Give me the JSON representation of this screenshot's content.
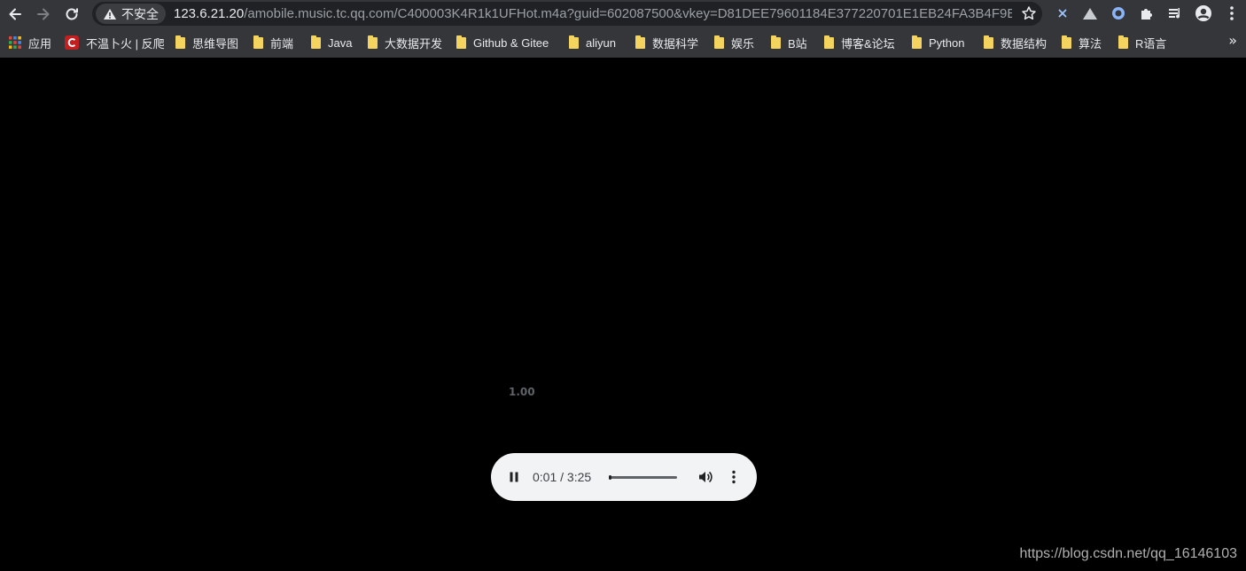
{
  "address_bar": {
    "security_label": "不安全",
    "url_host": "123.6.21.20",
    "url_path": "/amobile.music.tc.qq.com/C400003K4R1k1UFHot.m4a?guid=602087500&vkey=D81DEE79601184E377220701E1EB24FA3B4F9B..."
  },
  "bookmarks": [
    {
      "label": "应用",
      "icon": "apps-grid-icon"
    },
    {
      "label": "不温卜火 | 反爬",
      "icon": "csdn-icon"
    },
    {
      "label": "思维导图",
      "icon": "folder-icon"
    },
    {
      "label": "前端",
      "icon": "folder-icon"
    },
    {
      "label": "Java",
      "icon": "folder-icon"
    },
    {
      "label": "大数据开发",
      "icon": "folder-icon"
    },
    {
      "label": "Github & Gitee",
      "icon": "folder-icon"
    },
    {
      "label": "aliyun",
      "icon": "folder-icon"
    },
    {
      "label": "数据科学",
      "icon": "folder-icon"
    },
    {
      "label": "娱乐",
      "icon": "folder-icon"
    },
    {
      "label": "B站",
      "icon": "folder-icon"
    },
    {
      "label": "博客&论坛",
      "icon": "folder-icon"
    },
    {
      "label": "Python",
      "icon": "folder-icon"
    },
    {
      "label": "数据结构",
      "icon": "folder-icon"
    },
    {
      "label": "算法",
      "icon": "folder-icon"
    },
    {
      "label": "R语言",
      "icon": "folder-icon"
    }
  ],
  "bookmarks_overflow": "»",
  "media": {
    "playback_rate": "1.00",
    "time_display": "0:01 / 3:25",
    "progress": 0.005
  },
  "watermark": "https://blog.csdn.net/qq_16146103",
  "colors": {
    "chrome_bg": "#35363a",
    "omnibox_bg": "#202124",
    "player_bg": "#f1f3f4",
    "folder": "#f4d35e"
  }
}
